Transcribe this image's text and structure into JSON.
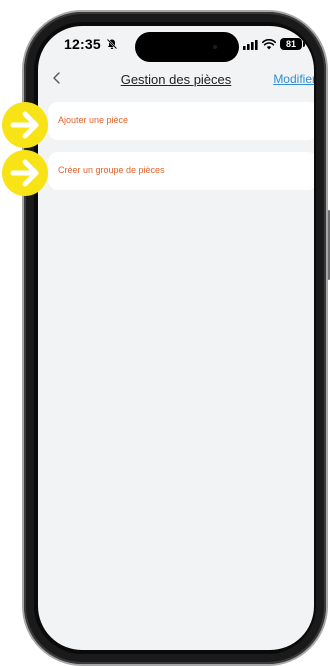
{
  "status_bar": {
    "time": "12:35",
    "battery": "81",
    "icons": [
      "bell-muted-icon",
      "signal-icon",
      "wifi-icon",
      "battery-icon"
    ]
  },
  "nav": {
    "back_icon": "chevron-left-icon",
    "title": "Gestion des pièces",
    "action": "Modifier"
  },
  "list": {
    "items": [
      {
        "label": "Ajouter une pièce"
      },
      {
        "label": "Créer un groupe de pièces"
      }
    ]
  },
  "annotations": {
    "marker_icon": "arrow-right-icon",
    "marker_color": "#f8e316"
  },
  "colors": {
    "accent": "#e2622d",
    "link": "#2f8fd3",
    "screen_bg": "#f2f3f5"
  }
}
